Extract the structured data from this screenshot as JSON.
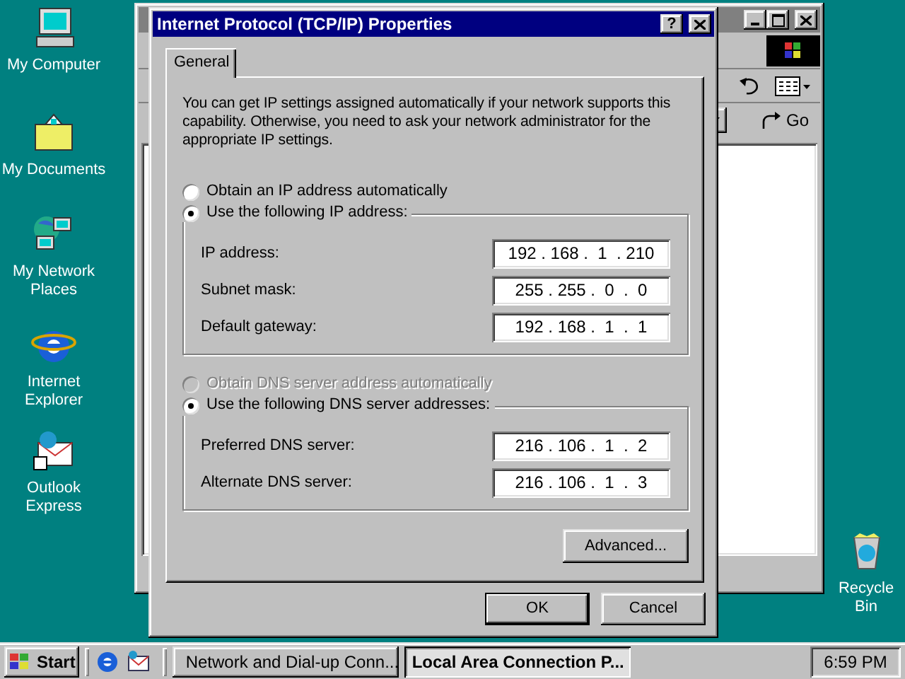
{
  "desktop_icons": [
    {
      "label": "My Computer",
      "kind": "computer"
    },
    {
      "label": "My Documents",
      "kind": "documents"
    },
    {
      "label": "My Network Places",
      "kind": "network"
    },
    {
      "label": "Internet Explorer",
      "kind": "browser"
    },
    {
      "label": "Outlook Express",
      "kind": "mail"
    },
    {
      "label": "Recycle Bin",
      "kind": "recycle"
    }
  ],
  "background_window": {
    "go_label": "Go"
  },
  "dialog": {
    "title": "Internet Protocol (TCP/IP) Properties",
    "help_label": "?",
    "tabs": [
      {
        "label": "General",
        "selected": true
      }
    ],
    "intro": "You can get IP settings assigned automatically if your network supports this capability. Otherwise, you need to ask your network administrator for the appropriate IP settings.",
    "ip_auto": {
      "label": "Obtain an IP address automatically",
      "selected": false,
      "disabled": false
    },
    "ip_manual": {
      "label": "Use the following IP address:",
      "selected": true,
      "disabled": false
    },
    "ip_fields": [
      {
        "label": "IP address:",
        "value": "192 . 168 .  1  . 210"
      },
      {
        "label": "Subnet mask:",
        "value": "255 . 255 .  0  .  0"
      },
      {
        "label": "Default gateway:",
        "value": "192 . 168 .  1  .  1"
      }
    ],
    "dns_auto": {
      "label": "Obtain DNS server address automatically",
      "selected": false,
      "disabled": true
    },
    "dns_manual": {
      "label": "Use the following DNS server addresses:",
      "selected": true,
      "disabled": false
    },
    "dns_fields": [
      {
        "label": "Preferred DNS server:",
        "value": "216 . 106 .  1  .  2"
      },
      {
        "label": "Alternate DNS server:",
        "value": "216 . 106 .  1  .  3"
      }
    ],
    "advanced_button": "Advanced...",
    "buttons": [
      "OK",
      "Cancel"
    ]
  },
  "taskbar": {
    "start": "Start",
    "tasks": [
      {
        "label": "Network and Dial-up Conn...",
        "selected": false
      },
      {
        "label": "Local Area Connection P...",
        "selected": true
      }
    ],
    "clock": "6:59 PM"
  }
}
